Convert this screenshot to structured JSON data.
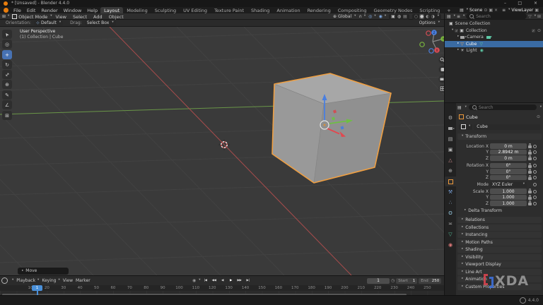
{
  "window": {
    "title": "* [Unsaved] - Blender 4.4.0",
    "controls": {
      "minimize": "–",
      "maximize": "□",
      "close": "×"
    }
  },
  "menubar": {
    "menus": [
      "File",
      "Edit",
      "Render",
      "Window",
      "Help"
    ],
    "workspaces": [
      "Layout",
      "Modeling",
      "Sculpting",
      "UV Editing",
      "Texture Paint",
      "Shading",
      "Animation",
      "Rendering",
      "Compositing",
      "Geometry Nodes",
      "Scripting"
    ],
    "active_workspace": "Layout",
    "add_workspace": "+",
    "scene": {
      "label": "Scene"
    },
    "view_layer": {
      "label": "ViewLayer"
    }
  },
  "viewport_header": {
    "mode": "Object Mode",
    "menus": [
      "View",
      "Select",
      "Add",
      "Object"
    ],
    "orientation": "Global"
  },
  "tool_settings": {
    "orientation_label": "Orientation:",
    "orientation_value": "Default",
    "drag_label": "Drag:",
    "drag_value": "Select Box",
    "options": "Options"
  },
  "viewport": {
    "overlay_line1": "User Perspective",
    "overlay_line2": "(1) Collection | Cube",
    "operator_panel": "Move",
    "nav_axes": {
      "x": "X",
      "y": "Y",
      "z": "Z"
    }
  },
  "outliner": {
    "search_placeholder": "Search",
    "rows": [
      {
        "label": "Scene Collection"
      },
      {
        "label": "Collection"
      },
      {
        "label": "Camera"
      },
      {
        "label": "Cube"
      },
      {
        "label": "Light"
      }
    ]
  },
  "properties": {
    "search_placeholder": "Search",
    "breadcrumb": "Cube",
    "object_name": "Cube",
    "transform": {
      "title": "Transform",
      "rows": [
        {
          "label": "Location X",
          "value": "0 m"
        },
        {
          "label": "Y",
          "value": "2.8942 m"
        },
        {
          "label": "Z",
          "value": "0 m"
        },
        {
          "label": "Rotation X",
          "value": "0°"
        },
        {
          "label": "Y",
          "value": "0°"
        },
        {
          "label": "Z",
          "value": "0°"
        }
      ],
      "mode_label": "Mode",
      "mode_value": "XYZ Euler",
      "scale_rows": [
        {
          "label": "Scale X",
          "value": "1.000"
        },
        {
          "label": "Y",
          "value": "1.000"
        },
        {
          "label": "Z",
          "value": "1.000"
        }
      ],
      "delta_label": "Delta Transform"
    },
    "panels": [
      "Relations",
      "Collections",
      "Instancing",
      "Motion Paths",
      "Shading",
      "Visibility",
      "Viewport Display",
      "Line Art",
      "Animation",
      "Custom Properties"
    ],
    "tabs": [
      "tool",
      "render",
      "output",
      "view-layer",
      "scene",
      "world",
      "object",
      "modifiers",
      "particles",
      "physics",
      "constraints",
      "object-data",
      "material"
    ]
  },
  "timeline": {
    "menus": [
      "Playback",
      "Keying",
      "View",
      "Marker"
    ],
    "current_frame": "1",
    "start_label": "Start",
    "start_value": "1",
    "end_label": "End",
    "end_value": "250",
    "ticks": [
      "10",
      "20",
      "30",
      "40",
      "50",
      "60",
      "70",
      "80",
      "90",
      "100",
      "110",
      "120",
      "130",
      "140",
      "150",
      "160",
      "170",
      "180",
      "190",
      "200",
      "210",
      "220",
      "230",
      "240",
      "250"
    ]
  },
  "statusbar": {
    "version": "4.4.0"
  },
  "watermark": {
    "text": "XDA"
  },
  "colors": {
    "selection_blue": "#4772b3",
    "object_orange": "#ef9f42",
    "axis_x": "#e2484f",
    "axis_y": "#6fbe45",
    "axis_z": "#4a7fe0",
    "viewport_bg": "#3a3a3a"
  }
}
